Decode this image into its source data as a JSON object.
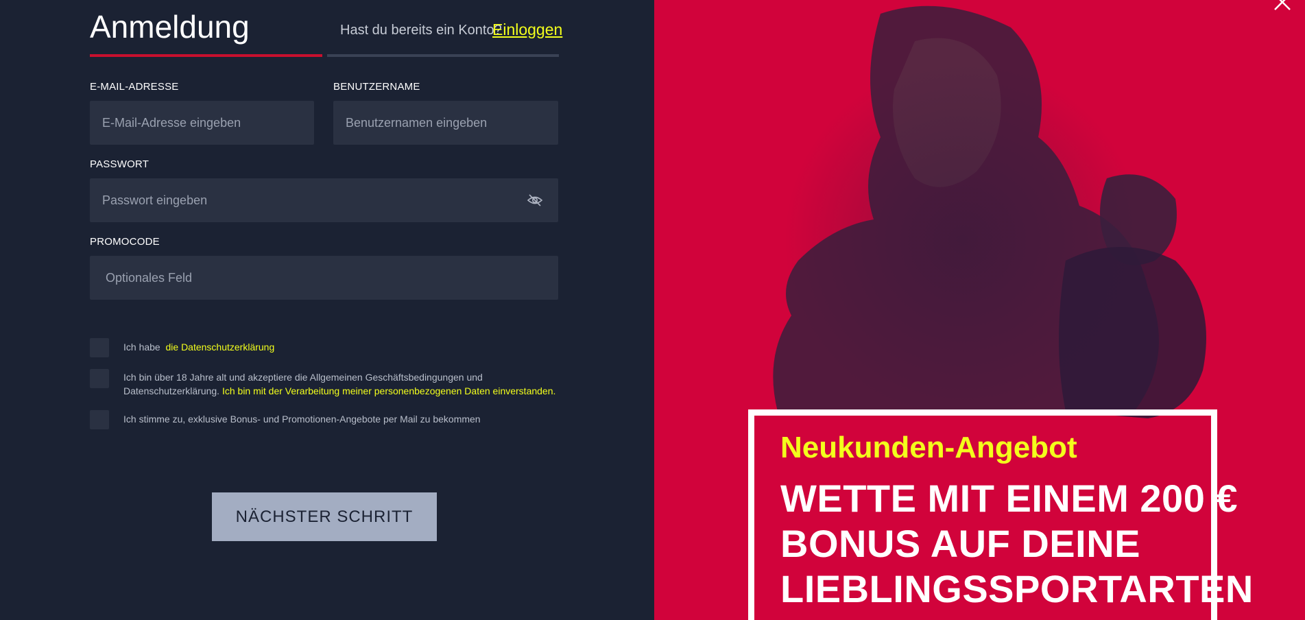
{
  "form": {
    "title": "Anmeldung",
    "has_account_text": "Hast du bereits ein Konto?",
    "login_link": "Einloggen",
    "email_label": "E-MAIL-ADRESSE",
    "email_placeholder": "E-Mail-Adresse eingeben",
    "username_label": "BENUTZERNAME",
    "username_placeholder": "Benutzernamen eingeben",
    "password_label": "PASSWORT",
    "password_placeholder": "Passwort eingeben",
    "promo_label": "PROMOCODE",
    "promo_placeholder": "Optionales Feld",
    "check1_text": "Ich habe",
    "check1_link": "die Datenschutzerklärung",
    "check2_text_line1": "Ich bin über 18 Jahre alt und akzeptiere die Allgemeinen Geschäftsbedingungen und",
    "check2_text_line2": "Datenschutzerklärung.",
    "check2_link": "Ich bin mit der Verarbeitung meiner personenbezogenen Daten einverstanden.",
    "check3_text": "Ich stimme zu, exklusive Bonus- und Promotionen-Angebote per Mail zu bekommen",
    "next_button": "NÄCHSTER SCHRITT"
  },
  "promo": {
    "subtitle": "Neukunden-Angebot",
    "line1": "WETTE MIT EINEM 200 €",
    "line2": "BONUS AUF DEINE",
    "line3": "LIEBLINGSSPORTARTEN"
  },
  "colors": {
    "background": "#1b2233",
    "field": "#2a3142",
    "accent_red": "#d1033b",
    "highlight_yellow": "#f3ff1c"
  }
}
